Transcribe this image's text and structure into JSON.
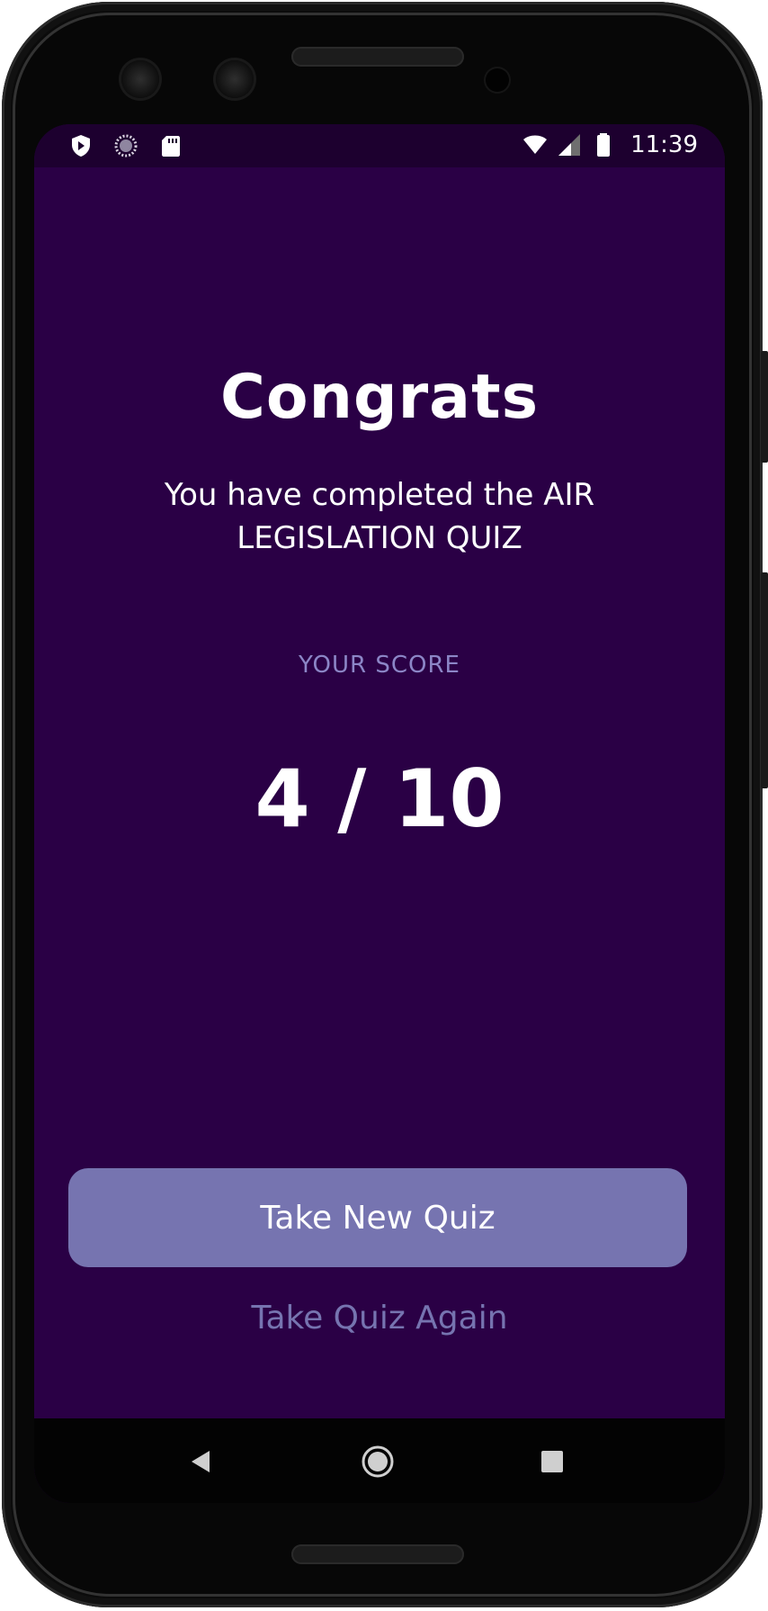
{
  "status_bar": {
    "time": "11:39",
    "icons": [
      "play-protect-icon",
      "sync-circle-icon",
      "sd-card-icon",
      "wifi-icon",
      "signal-icon",
      "battery-icon"
    ]
  },
  "results": {
    "headline": "Congrats",
    "subtitle": "You have completed the AIR LEGISLATION QUIZ",
    "score_label": "YOUR SCORE",
    "score": "4 / 10"
  },
  "actions": {
    "primary_label": "Take New Quiz",
    "secondary_label": "Take Quiz Again"
  },
  "nav_bar": {
    "icons": [
      "back-icon",
      "home-icon",
      "recents-icon"
    ]
  },
  "colors": {
    "background": "#2a0045",
    "status_bar": "#1d002f",
    "accent": "#7674b0",
    "muted_label": "#8c86c7",
    "text": "#ffffff"
  }
}
